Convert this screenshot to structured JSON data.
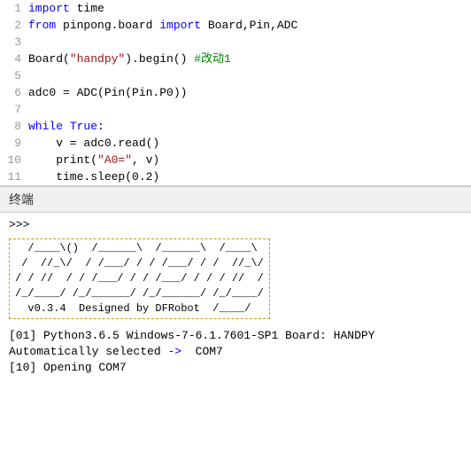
{
  "editor": {
    "lines": [
      {
        "num": "1",
        "tokens": [
          {
            "text": "import",
            "cls": "kw"
          },
          {
            "text": " time",
            "cls": "plain"
          }
        ]
      },
      {
        "num": "2",
        "tokens": [
          {
            "text": "from",
            "cls": "kw"
          },
          {
            "text": " pinpong.board ",
            "cls": "plain"
          },
          {
            "text": "import",
            "cls": "kw"
          },
          {
            "text": " Board,Pin,ADC",
            "cls": "plain"
          }
        ]
      },
      {
        "num": "3",
        "tokens": []
      },
      {
        "num": "4",
        "tokens": [
          {
            "text": "Board(",
            "cls": "plain"
          },
          {
            "text": "\"handpy\"",
            "cls": "str"
          },
          {
            "text": ").begin() ",
            "cls": "plain"
          },
          {
            "text": "#改动1",
            "cls": "cm"
          }
        ]
      },
      {
        "num": "5",
        "tokens": []
      },
      {
        "num": "6",
        "tokens": [
          {
            "text": "adc0 = ADC(Pin(Pin.P0))",
            "cls": "plain"
          }
        ]
      },
      {
        "num": "7",
        "tokens": []
      },
      {
        "num": "8",
        "tokens": [
          {
            "text": "while",
            "cls": "kw"
          },
          {
            "text": " ",
            "cls": "plain"
          },
          {
            "text": "True",
            "cls": "kw"
          },
          {
            "text": ":",
            "cls": "plain"
          }
        ]
      },
      {
        "num": "9",
        "tokens": [
          {
            "text": "    v = adc0.read()",
            "cls": "plain"
          }
        ]
      },
      {
        "num": "10",
        "tokens": [
          {
            "text": "    print(",
            "cls": "plain"
          },
          {
            "text": "\"A0=\"",
            "cls": "str"
          },
          {
            "text": ", v)",
            "cls": "plain"
          }
        ]
      },
      {
        "num": "11",
        "tokens": [
          {
            "text": "    time.sleep(0.2)",
            "cls": "plain"
          }
        ]
      }
    ]
  },
  "terminal": {
    "label": "终端",
    "prompt": ">>>",
    "ascii_art": [
      "  /____\\()  /______\\  /______\\  /____\\",
      " /  //_\\/  / /___/ / / /___/ / /  //_\\/",
      "/ / //  / / /___/ / / /___/ / / / //  /",
      "/_/____/ /_/______/ /_/______/ /_/____/",
      "  v0.3.4  Designed by DFRobot  /____/"
    ],
    "output_lines": [
      "[01] Python3.6.5 Windows-7-6.1.7601-SP1 Board: HANDPY",
      "Automatically selected ->  COM7",
      "[10] Opening COM7"
    ],
    "arrow_text": "->"
  }
}
